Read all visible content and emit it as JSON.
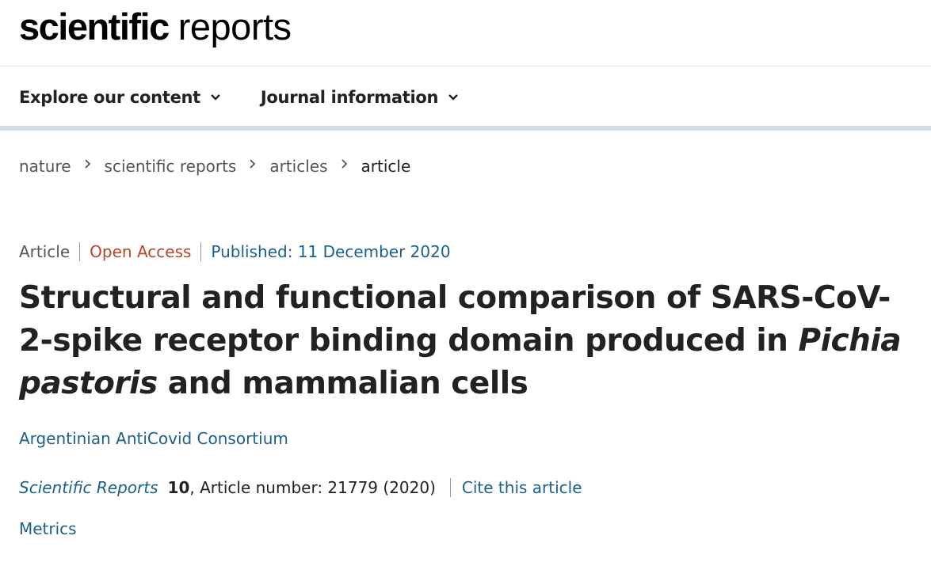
{
  "brand": {
    "bold": "scientific",
    "light": "reports"
  },
  "nav": {
    "items": [
      {
        "label": "Explore our content"
      },
      {
        "label": "Journal information"
      }
    ]
  },
  "breadcrumb": [
    "nature",
    "scientific reports",
    "articles",
    "article"
  ],
  "article": {
    "type": "Article",
    "access": "Open Access",
    "published": "Published: 11 December 2020",
    "title_part1": "Structural and functional comparison of SARS-CoV-2-spike receptor binding domain produced in ",
    "title_italic": "Pichia pastoris",
    "title_part2": " and mammalian cells",
    "author": "Argentinian AntiCovid Consortium",
    "journal": "Scientific Reports",
    "volume": "10",
    "article_info": ", Article number: 21779 (2020)",
    "cite_label": "Cite this article",
    "metrics_label": "Metrics"
  },
  "colors": {
    "link": "#1a5f8d",
    "open_access": "#b6442b",
    "nav_rule": "#d3dde4"
  },
  "icons": {
    "dropdown": "chevron-down-icon",
    "breadcrumb_separator": "chevron-right-icon"
  }
}
